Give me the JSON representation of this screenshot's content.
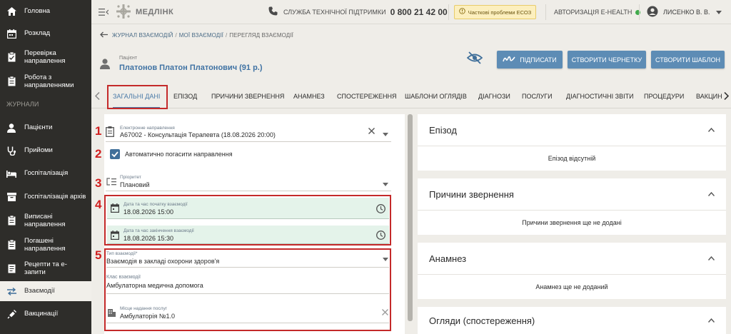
{
  "sidebar": {
    "items": [
      {
        "label": "Головна",
        "icon": "home-icon"
      },
      {
        "label": "Розклад",
        "icon": "calendar-icon"
      },
      {
        "label": "Перевірка направлення",
        "icon": "clipboard-check-icon"
      },
      {
        "label": "Робота з направленнями",
        "icon": "clipboard-icon"
      },
      {
        "label": "Пацієнти",
        "icon": "person-icon"
      },
      {
        "label": "Прийоми",
        "icon": "stethoscope-icon"
      },
      {
        "label": "Госпіталізація",
        "icon": "bed-icon"
      },
      {
        "label": "Госпіталізація архів",
        "icon": "archive-icon"
      },
      {
        "label": "Виписані направлення",
        "icon": "clipboard-icon"
      },
      {
        "label": "Погашені направлення",
        "icon": "clipboard-icon"
      },
      {
        "label": "Рецепти та е-запити",
        "icon": "receipt-icon"
      },
      {
        "label": "Взаємодії",
        "icon": "swap-icon"
      },
      {
        "label": "Вакцинації",
        "icon": "syringe-icon"
      }
    ],
    "section_label": "ЖУРНАЛИ"
  },
  "header": {
    "logo_text": "МЕДЛІНК",
    "support_label": "СЛУЖБА ТЕХНІЧНОЇ ПІДТРИМКИ",
    "support_phone": "0 800 21 42 00",
    "eco_warning": "Часткові проблеми ЕСОЗ",
    "ehealth_label": "АВТОРИЗАЦІЯ E-HEALTH",
    "user_name": "ЛИСЕНКО В. В."
  },
  "breadcrumb": [
    "ЖУРНАЛ ВЗАЄМОДІЙ",
    "МОЇ ВЗАЄМОДІЇ",
    "ПЕРЕГЛЯД ВЗАЄМОДІЇ"
  ],
  "patient": {
    "label": "Пацієнт",
    "name": "Платонов Платон Платонович (91 р.)"
  },
  "actions": {
    "sign": "ПІДПИСАТИ",
    "draft": "СТВОРИТИ ЧЕРНЕТКУ",
    "template": "СТВОРИТИ ШАБЛОН"
  },
  "tabs": [
    "ЗАГАЛЬНІ ДАНІ",
    "ЕПІЗОД",
    "ПРИЧИНИ ЗВЕРНЕННЯ",
    "АНАМНЕЗ",
    "СПОСТЕРЕЖЕННЯ",
    "ШАБЛОНИ ОГЛЯДІВ",
    "ДІАГНОЗИ",
    "ПОСЛУГИ",
    "ДІАГНОСТИЧНІ ЗВІТИ",
    "ПРОЦЕДУРИ",
    "ВАКЦИН"
  ],
  "form": {
    "referral_label": "Електронне направлення",
    "referral_value": "А67002 - Консультація Терапевта (18.08.2026 20:00)",
    "auto_close_label": "Автоматично погасити направлення",
    "priority_label": "Пріоритет",
    "priority_value": "Плановий",
    "start_label": "Дата та час початку взаємодії",
    "start_value": "18.08.2026 15:00",
    "end_label": "Дата та час закінчення взаємодії",
    "end_value": "18.08.2026 15:30",
    "type_label": "Тип взаємодії*",
    "type_value": "Взаємодія в закладі охорони здоров'я",
    "class_label": "Клас взаємодії",
    "class_value": "Амбулаторна медична допомога",
    "place_label": "Місце надання послуг",
    "place_value": "Амбулаторія №1.0"
  },
  "markers": [
    "1",
    "2",
    "3",
    "4",
    "5"
  ],
  "cards": [
    {
      "title": "Епізод",
      "body": "Епізод відсутній"
    },
    {
      "title": "Причини звернення",
      "body": "Причини звернення ще не додані"
    },
    {
      "title": "Анамнез",
      "body": "Анамнез ще не доданий"
    },
    {
      "title": "Огляди (спостереження)",
      "body": ""
    }
  ],
  "colors": {
    "accent": "#5d8cb5",
    "sidebar": "#2e2d2a",
    "highlight": "#c42a2a",
    "green_field": "#e4f3ea"
  }
}
